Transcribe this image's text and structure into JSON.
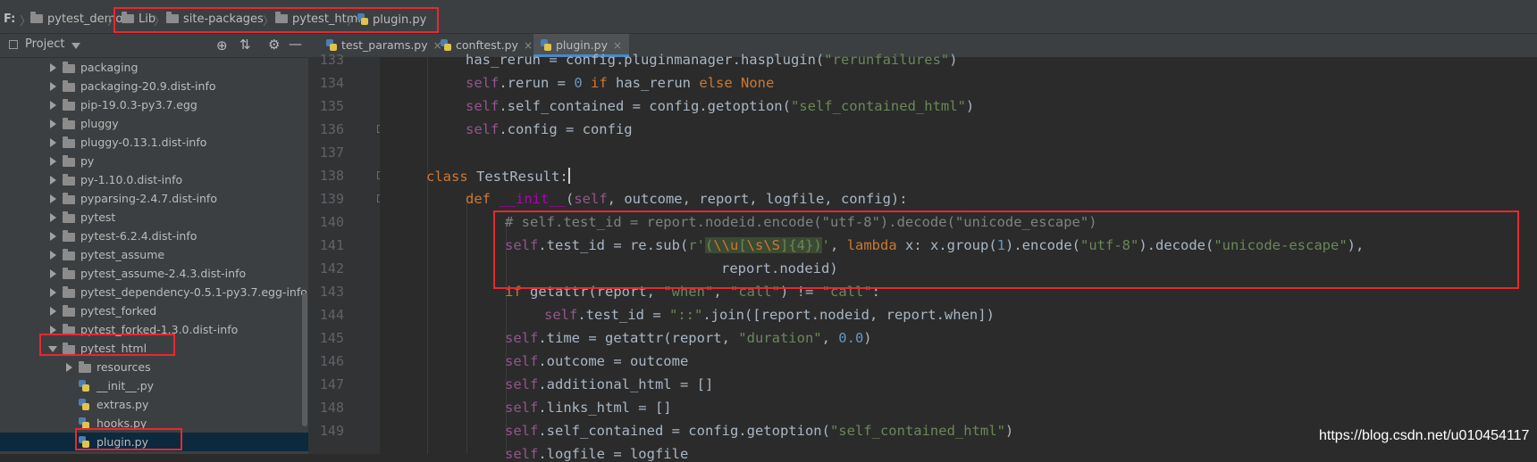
{
  "breadcrumb": {
    "drive": "F:",
    "items": [
      "pytest_demo",
      "Lib",
      "site-packages",
      "pytest_html",
      "plugin.py"
    ]
  },
  "project_header": {
    "label": "Project"
  },
  "tree": [
    {
      "label": "packaging",
      "type": "folder",
      "state": "collapsed"
    },
    {
      "label": "packaging-20.9.dist-info",
      "type": "folder",
      "state": "collapsed"
    },
    {
      "label": "pip-19.0.3-py3.7.egg",
      "type": "folder",
      "state": "collapsed"
    },
    {
      "label": "pluggy",
      "type": "folder",
      "state": "collapsed"
    },
    {
      "label": "pluggy-0.13.1.dist-info",
      "type": "folder",
      "state": "collapsed"
    },
    {
      "label": "py",
      "type": "folder",
      "state": "collapsed"
    },
    {
      "label": "py-1.10.0.dist-info",
      "type": "folder",
      "state": "collapsed"
    },
    {
      "label": "pyparsing-2.4.7.dist-info",
      "type": "folder",
      "state": "collapsed"
    },
    {
      "label": "pytest",
      "type": "folder",
      "state": "collapsed"
    },
    {
      "label": "pytest-6.2.4.dist-info",
      "type": "folder",
      "state": "collapsed"
    },
    {
      "label": "pytest_assume",
      "type": "folder",
      "state": "collapsed"
    },
    {
      "label": "pytest_assume-2.4.3.dist-info",
      "type": "folder",
      "state": "collapsed"
    },
    {
      "label": "pytest_dependency-0.5.1-py3.7.egg-info",
      "type": "folder",
      "state": "collapsed"
    },
    {
      "label": "pytest_forked",
      "type": "folder",
      "state": "collapsed"
    },
    {
      "label": "pytest_forked-1.3.0.dist-info",
      "type": "folder",
      "state": "collapsed"
    },
    {
      "label": "pytest_html",
      "type": "folder",
      "state": "expanded"
    },
    {
      "label": "resources",
      "type": "folder",
      "state": "collapsed"
    },
    {
      "label": "__init__.py",
      "type": "file"
    },
    {
      "label": "extras.py",
      "type": "file"
    },
    {
      "label": "hooks.py",
      "type": "file"
    },
    {
      "label": "plugin.py",
      "type": "file",
      "selected": true
    }
  ],
  "tabs": [
    {
      "label": "test_params.py",
      "active": false
    },
    {
      "label": "conftest.py",
      "active": false
    },
    {
      "label": "plugin.py",
      "active": true
    }
  ],
  "line_numbers": [
    "133",
    "134",
    "135",
    "136",
    "137",
    "138",
    "139",
    "140",
    "141",
    "142",
    "143",
    "144",
    "145",
    "146",
    "147",
    "148",
    "149"
  ],
  "code": {
    "l133_a": "has_rerun = config.pluginmanager.hasplugin(",
    "l133_s": "\"rerunfailures\"",
    "l133_b": ")",
    "self": "self",
    "l134_a": ".rerun = ",
    "l134_n": "0",
    "l134_if": " if ",
    "l134_b": "has_rerun ",
    "l134_else": "else ",
    "l134_none": "None",
    "l135_a": ".self_contained = config.getoption(",
    "l135_s": "\"self_contained_html\"",
    "l135_b": ")",
    "l136_a": ".config = config",
    "l138_kw": "class ",
    "l138_name": "TestResult:",
    "l139_kw": "def ",
    "l139_fn": "__init__",
    "l139_a": "(",
    "l139_b": ", outcome, report, logfile, config):",
    "l140": "# self.test_id = report.nodeid.encode(\"utf-8\").decode(\"unicode_escape\")",
    "l141_a": ".test_id = re.sub(",
    "l141_r": "r'",
    "l141_p1": "(",
    "l141_e1": "\\\\u",
    "l141_p2": "[",
    "l141_e2": "\\s\\S",
    "l141_p3": "]{4}",
    "l141_p4": ")",
    "l141_q": "'",
    "l141_b": ", ",
    "l141_lambda": "lambda ",
    "l141_c": "x: x.group(",
    "l141_n": "1",
    "l141_d": ").encode(",
    "l141_s1": "\"utf-8\"",
    "l141_e": ").decode(",
    "l141_s2": "\"unicode-escape\"",
    "l141_f": "),",
    "l142": "report.nodeid)",
    "l143_kw": "if ",
    "l143_a": "getattr(report, ",
    "l143_s1": "\"when\"",
    "l143_b": ", ",
    "l143_s2": "\"call\"",
    "l143_c": ") != ",
    "l143_s3": "\"call\"",
    "l143_d": ":",
    "l144_a": ".test_id = ",
    "l144_s": "\"::\"",
    "l144_b": ".join([report.nodeid, report.when])",
    "l145_a": ".time = getattr(report, ",
    "l145_s": "\"duration\"",
    "l145_b": ", ",
    "l145_n": "0.0",
    "l145_c": ")",
    "l146_a": ".outcome = outcome",
    "l147_a": ".additional_html = []",
    "l148_a": ".links_html = []",
    "l149_a": ".self_contained = config.getoption(",
    "l149_s": "\"self_contained_html\"",
    "l149_b": ")",
    "l150_a": ".logfile = logfile"
  },
  "watermark": "https://blog.csdn.net/u010454117",
  "colors": {
    "highlight": "#e8282f",
    "keyword": "#cc7832",
    "string": "#6a8759",
    "self": "#94558d"
  }
}
